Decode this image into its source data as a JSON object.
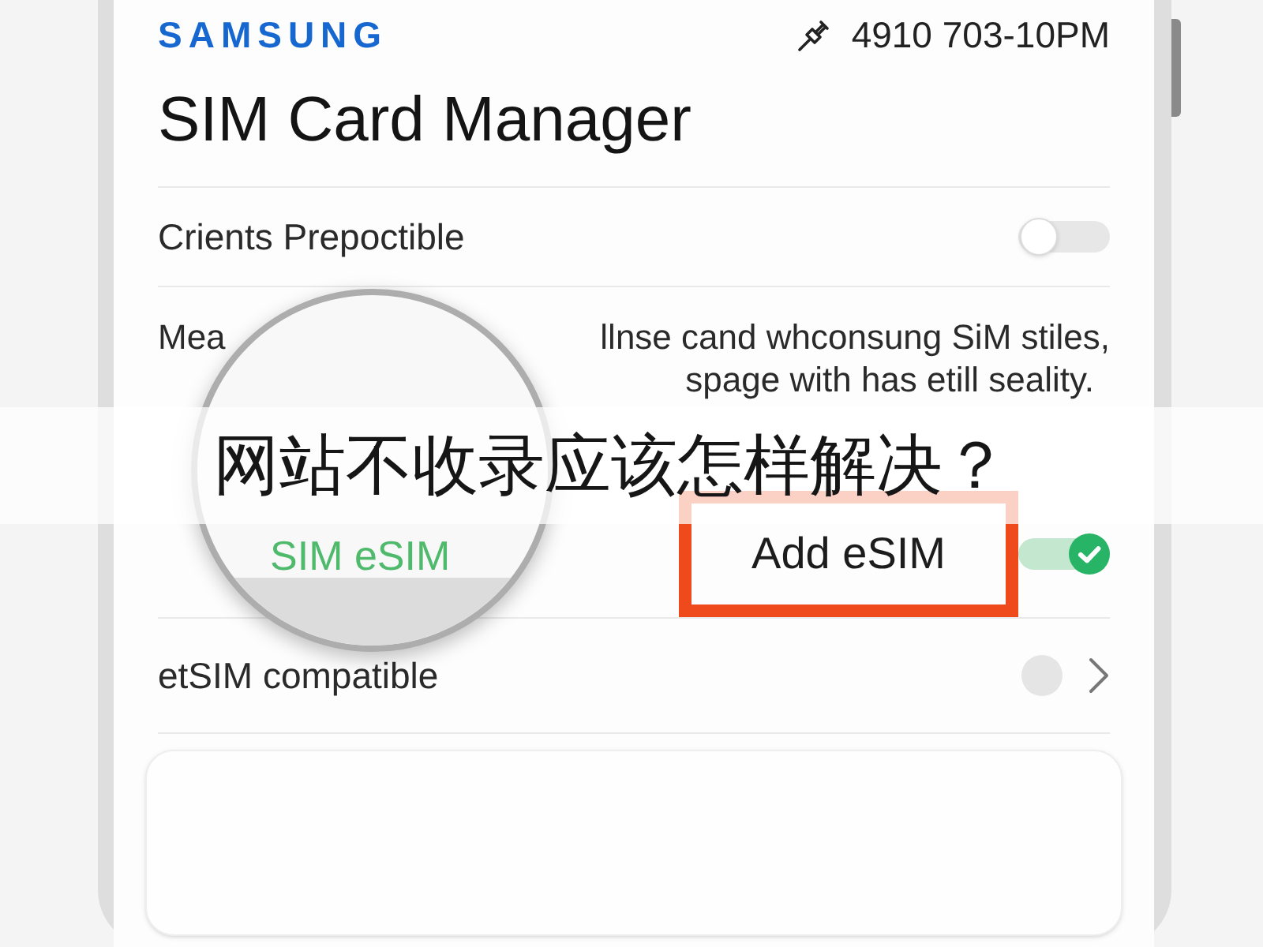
{
  "status_bar": {
    "brand": "SAMSUNG",
    "info": "4910 703-10PM"
  },
  "title": "SIM Card Manager",
  "rows": [
    {
      "kind": "toggle",
      "label": "Crients Prepoctible",
      "on": false
    },
    {
      "kind": "note",
      "lines": [
        [
          "Mea",
          "llnse cand whconsung SiM stiles,"
        ],
        [
          "spage with has etill seality."
        ]
      ]
    },
    {
      "kind": "highlighted_toggle",
      "label": "Add eSIM",
      "on": true
    },
    {
      "kind": "radio_link",
      "label": "etSIM compatible",
      "selected": false
    }
  ],
  "magnifier": {
    "label": "SIM eSIM"
  },
  "caption": "网站不收录应该怎样解决？"
}
